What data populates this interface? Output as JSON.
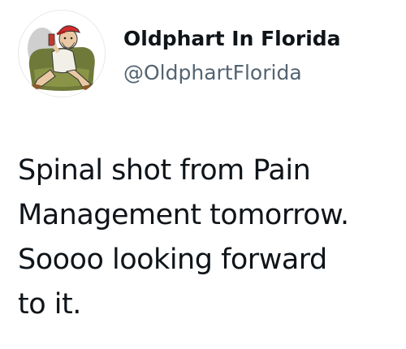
{
  "tweet": {
    "author": {
      "display_name": "Oldphart In Florida",
      "handle": "@OldphartFlorida",
      "avatar_icon": "cartoon-old-man-avatar-icon"
    },
    "text_lines": [
      "Spinal shot from Pain",
      "Management tomorrow.",
      "Soooo looking forward",
      "to it."
    ]
  },
  "colors": {
    "text_primary": "#0f1419",
    "text_secondary": "#536471",
    "background": "#ffffff"
  }
}
